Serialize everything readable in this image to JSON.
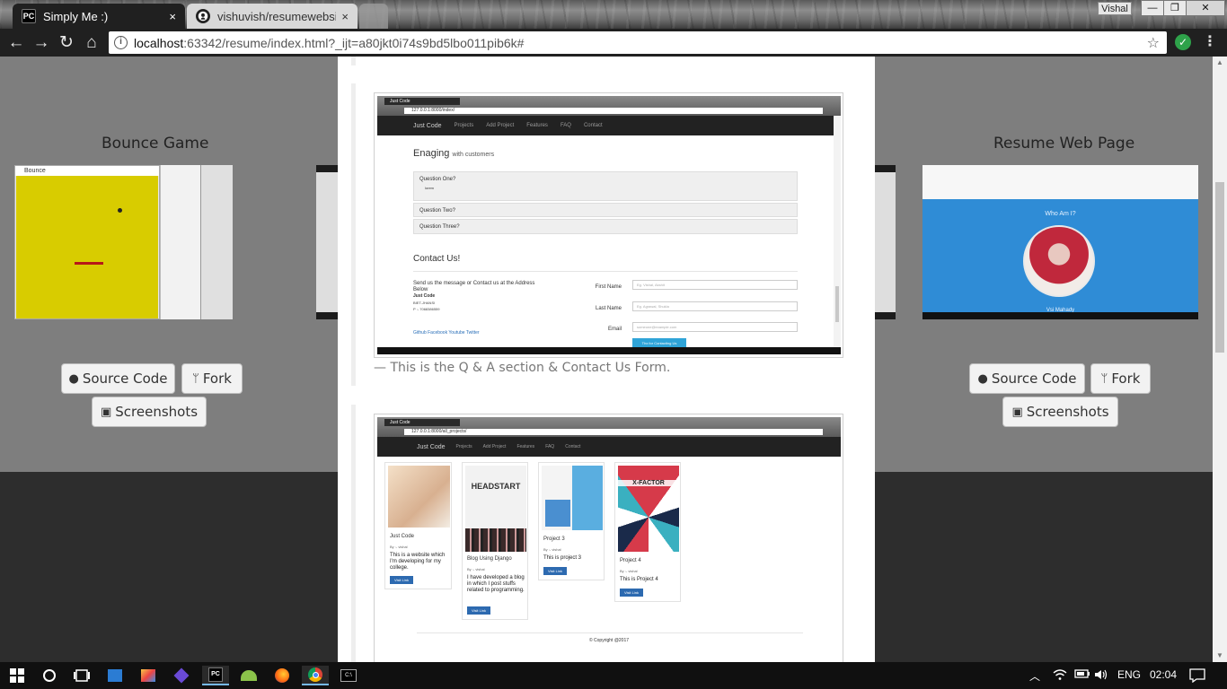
{
  "browser": {
    "tabs": [
      {
        "favicon": "PC",
        "title": "Simply Me :)",
        "close": "×"
      },
      {
        "favicon": "GH",
        "title": "vishuvish/resumewebsite",
        "close": "×"
      }
    ],
    "user_chip": "Vishal",
    "window_controls": {
      "minimize": "—",
      "maximize": "❐",
      "close": "✕"
    },
    "nav": {
      "back": "←",
      "forward": "→",
      "reload": "↻",
      "home": "⌂"
    },
    "url_host": "localhost",
    "url_rest": ":63342/resume/index.html?_ijt=a80jkt0i74s9bd5lbo011pib6k#",
    "star": "☆",
    "extension_check": "✓",
    "menu": "⋮"
  },
  "left_card": {
    "title": "Bounce Game",
    "buttons": {
      "source": "Source Code",
      "fork": "Fork",
      "screenshots": "Screenshots"
    },
    "thumb_window_title": "Bounce"
  },
  "right_card": {
    "title": "Resume Web Page",
    "buttons": {
      "source": "Source Code",
      "fork": "Fork",
      "screenshots": "Screenshots"
    },
    "thumb": {
      "heading": "Who Am I?",
      "name": "Vsi Mahady"
    }
  },
  "screenshot1": {
    "tab_title": "Just Code",
    "address": "127.0.0.1:8000/index/",
    "nav": {
      "brand": "Just Code",
      "links": [
        "Projects",
        "Add Project",
        "Features",
        "FAQ",
        "Contact"
      ]
    },
    "heading": "Enaging",
    "heading_small": "with customers",
    "questions": [
      {
        "q": "Question One?",
        "a": "lorem"
      },
      {
        "q": "Question Two?"
      },
      {
        "q": "Question Three?"
      }
    ],
    "contact_heading": "Contact Us!",
    "contact_text": "Send us the message or Contact us at the Address Below",
    "org": "Just Code",
    "addr1": "BIET-JHANSI",
    "phone": "P :- 7068386559",
    "links": "Github   Facebook   Youtube   Twitter",
    "fields": [
      {
        "label": "First Name",
        "placeholder": "Eg. Vishal, Akshit"
      },
      {
        "label": "Last Name",
        "placeholder": "Eg. Agrawal, Shukla"
      },
      {
        "label": "Email",
        "placeholder": "someone@example.com"
      }
    ],
    "submit": "Thx for Contacting Us",
    "caption": "— This is the Q & A section & Contact Us Form."
  },
  "screenshot2": {
    "tab_title": "Just Code",
    "address": "127.0.0.1:8000/all_projects/",
    "nav": {
      "brand": "Just Code",
      "links": [
        "Projects",
        "Add Project",
        "Features",
        "FAQ",
        "Contact"
      ]
    },
    "projects": [
      {
        "title": "Just Code",
        "by": "By :- vishal",
        "desc": "This is a website which I'm developing for my college.",
        "link": "Visit Link"
      },
      {
        "title": "Blog Using Django",
        "by": "By :- vishal",
        "desc": "I have developed a blog in which I post stuffs related to programming.",
        "link": "Visit Link",
        "poster": "HEADSTART"
      },
      {
        "title": "Project 3",
        "by": "By :- vishal",
        "desc": "This is project 3",
        "link": "Visit Link"
      },
      {
        "title": "Project 4",
        "by": "By :- vishal",
        "desc": "This is Project 4",
        "link": "Visit Link",
        "poster": "X-FACTOR"
      }
    ],
    "footer": "© Copyright @2017"
  },
  "taskbar": {
    "apps": [
      "windows-start",
      "cortana",
      "task-view",
      "outlook",
      "paint",
      "git",
      "pycharm",
      "android-studio",
      "firefox",
      "chrome",
      "cmd"
    ],
    "lang": "ENG",
    "time": "02:04"
  }
}
